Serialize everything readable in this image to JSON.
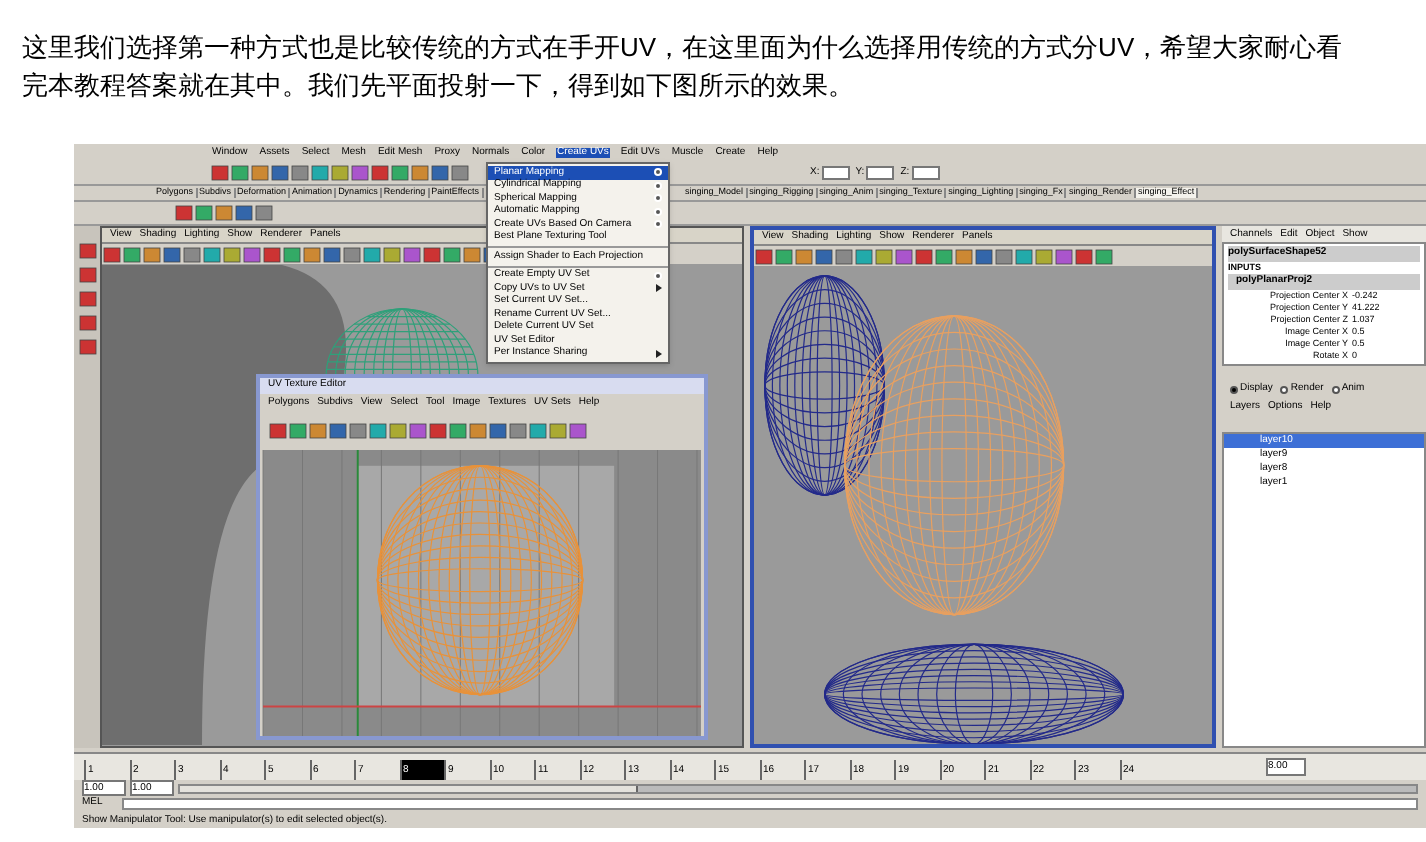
{
  "intro": {
    "text": "这里我们选择第一种方式也是比较传统的方式在手开UV，在这里面为什么选择用传统的方式分UV，希望大家耐心看完本教程答案就在其中。我们先平面投射一下，得到如下图所示的效果。"
  },
  "screenshot": {
    "menu_bar": [
      {
        "label": "Window",
        "selected": false
      },
      {
        "label": "Assets",
        "selected": false
      },
      {
        "label": "Select",
        "selected": false
      },
      {
        "label": "Mesh",
        "selected": false
      },
      {
        "label": "Edit Mesh",
        "selected": false
      },
      {
        "label": "Proxy",
        "selected": false
      },
      {
        "label": "Normals",
        "selected": false
      },
      {
        "label": "Color",
        "selected": false
      },
      {
        "label": "Create UVs",
        "selected": true
      },
      {
        "label": "Edit UVs",
        "selected": false
      },
      {
        "label": "Muscle",
        "selected": false
      },
      {
        "label": "Create",
        "selected": false
      },
      {
        "label": "Help",
        "selected": false
      }
    ],
    "create_uvs_menu": [
      [
        {
          "label": "Planar Mapping",
          "selected": true,
          "option_box": true,
          "submenu": false
        },
        {
          "label": "Cylindrical Mapping",
          "selected": false,
          "option_box": true,
          "submenu": false
        },
        {
          "label": "Spherical Mapping",
          "selected": false,
          "option_box": true,
          "submenu": false
        },
        {
          "label": "Automatic Mapping",
          "selected": false,
          "option_box": true,
          "submenu": false
        },
        {
          "label": "Create UVs Based On Camera",
          "selected": false,
          "option_box": true,
          "submenu": false
        },
        {
          "label": "Best Plane Texturing Tool",
          "selected": false,
          "option_box": false,
          "submenu": false
        }
      ],
      [
        {
          "label": "Assign Shader to Each Projection",
          "selected": false,
          "option_box": false,
          "submenu": false
        }
      ],
      [
        {
          "label": "Create Empty UV Set",
          "selected": false,
          "option_box": true,
          "submenu": false
        },
        {
          "label": "Copy UVs to UV Set",
          "selected": false,
          "option_box": false,
          "submenu": true
        },
        {
          "label": "Set Current UV Set...",
          "selected": false,
          "option_box": false,
          "submenu": false
        },
        {
          "label": "Rename Current UV Set...",
          "selected": false,
          "option_box": false,
          "submenu": false
        },
        {
          "label": "Delete Current UV Set",
          "selected": false,
          "option_box": false,
          "submenu": false
        },
        {
          "label": "UV Set Editor",
          "selected": false,
          "option_box": false,
          "submenu": false
        },
        {
          "label": "Per Instance Sharing",
          "selected": false,
          "option_box": false,
          "submenu": true
        }
      ]
    ],
    "field_labels": [
      "X:",
      "Y:",
      "Z:"
    ],
    "shelf_tabs": [
      {
        "label": "Polygons",
        "selected": false
      },
      {
        "label": "Subdivs",
        "selected": false
      },
      {
        "label": "Deformation",
        "selected": false
      },
      {
        "label": "Animation",
        "selected": false
      },
      {
        "label": "Dynamics",
        "selected": false
      },
      {
        "label": "Rendering",
        "selected": false
      },
      {
        "label": "PaintEffects",
        "selected": false
      },
      {
        "label": "singing_Model",
        "selected": false
      },
      {
        "label": "singing_Rigging",
        "selected": false
      },
      {
        "label": "singing_Anim",
        "selected": false
      },
      {
        "label": "singing_Texture",
        "selected": false
      },
      {
        "label": "singing_Lighting",
        "selected": false
      },
      {
        "label": "singing_Fx",
        "selected": false
      },
      {
        "label": "singing_Render",
        "selected": false
      },
      {
        "label": "singing_Effect",
        "selected": true
      }
    ],
    "viewport_menus": [
      [
        "View",
        "Shading",
        "Lighting",
        "Show",
        "Renderer",
        "Panels"
      ],
      [
        "View",
        "Shading",
        "Lighting",
        "Show",
        "Renderer",
        "Panels"
      ]
    ],
    "uv_editor": {
      "title": "UV Texture Editor",
      "menus": [
        "Polygons",
        "Subdivs",
        "View",
        "Select",
        "Tool",
        "Image",
        "Textures",
        "UV Sets",
        "Help"
      ]
    },
    "channel_box": {
      "menus": [
        "Channels",
        "Edit",
        "Object",
        "Show"
      ],
      "shape": "polySurfaceShape52",
      "inputs": "INPUTS",
      "node": "polyPlanarProj2",
      "attributes": [
        {
          "name": "Projection Center X",
          "value": "-0.242"
        },
        {
          "name": "Projection Center Y",
          "value": "41.222"
        },
        {
          "name": "Projection Center Z",
          "value": "1.037"
        },
        {
          "name": "Image Center X",
          "value": "0.5"
        },
        {
          "name": "Image Center Y",
          "value": "0.5"
        },
        {
          "name": "Rotate X",
          "value": "0"
        }
      ]
    },
    "layer_editor": {
      "modes": [
        {
          "label": "Display",
          "selected": true
        },
        {
          "label": "Render",
          "selected": false
        },
        {
          "label": "Anim",
          "selected": false
        }
      ],
      "menus": [
        "Layers",
        "Options",
        "Help"
      ],
      "layers": [
        {
          "name": "layer10",
          "selected": true
        },
        {
          "name": "layer9",
          "selected": false
        },
        {
          "name": "layer8",
          "selected": false
        },
        {
          "name": "layer1",
          "selected": false
        }
      ]
    },
    "timeline": [
      {
        "label": "1",
        "selected": false
      },
      {
        "label": "2",
        "selected": false
      },
      {
        "label": "3",
        "selected": false
      },
      {
        "label": "4",
        "selected": false
      },
      {
        "label": "5",
        "selected": false
      },
      {
        "label": "6",
        "selected": false
      },
      {
        "label": "7",
        "selected": false
      },
      {
        "label": "8",
        "selected": true
      },
      {
        "label": "9",
        "selected": false
      },
      {
        "label": "10",
        "selected": false
      },
      {
        "label": "11",
        "selected": false
      },
      {
        "label": "12",
        "selected": false
      },
      {
        "label": "13",
        "selected": false
      },
      {
        "label": "14",
        "selected": false
      },
      {
        "label": "15",
        "selected": false
      },
      {
        "label": "16",
        "selected": false
      },
      {
        "label": "17",
        "selected": false
      },
      {
        "label": "18",
        "selected": false
      },
      {
        "label": "19",
        "selected": false
      },
      {
        "label": "20",
        "selected": false
      },
      {
        "label": "21",
        "selected": false
      },
      {
        "label": "22",
        "selected": false
      },
      {
        "label": "23",
        "selected": false
      },
      {
        "label": "24",
        "selected": false
      }
    ],
    "current_time": "8.00",
    "range_fields": [
      "1.00",
      "1.00"
    ],
    "range_slider": {
      "level": 0.37
    },
    "command_label": "MEL",
    "help_line": "Show Manipulator Tool: Use manipulator(s) to edit selected object(s)."
  }
}
